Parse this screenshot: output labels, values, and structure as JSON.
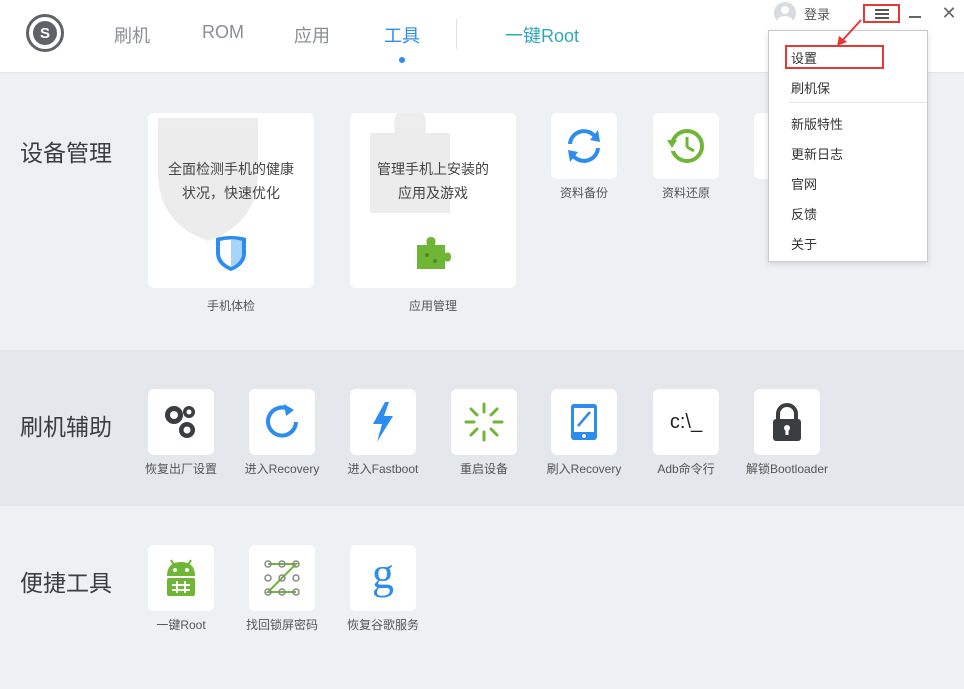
{
  "nav": {
    "tabs": [
      "刷机",
      "ROM",
      "应用",
      "工具"
    ],
    "root_tab": "一键Root"
  },
  "header": {
    "login": "登录"
  },
  "menu": {
    "items": [
      "设置",
      "刷机保",
      "新版特性",
      "更新日志",
      "官网",
      "反馈",
      "关于"
    ]
  },
  "sections": {
    "device": {
      "title": "设备管理",
      "check_card": {
        "desc_line1": "全面检测手机的健康",
        "desc_line2": "状况，快速优化",
        "label": "手机体检"
      },
      "app_card": {
        "desc_line1": "管理手机上安装的",
        "desc_line2": "应用及游戏",
        "label": "应用管理"
      },
      "tiles": [
        "资料备份",
        "资料还原"
      ]
    },
    "flash": {
      "title": "刷机辅助",
      "tiles": [
        "恢复出厂设置",
        "进入Recovery",
        "进入Fastboot",
        "重启设备",
        "刷入Recovery",
        "Adb命令行",
        "解锁Bootloader"
      ],
      "adb_glyph": "c:\\_"
    },
    "tools": {
      "title": "便捷工具",
      "tiles": [
        "一键Root",
        "找回锁屏密码",
        "恢复谷歌服务"
      ],
      "google_glyph": "g"
    }
  },
  "colors": {
    "accent": "#2d8cf0",
    "green": "#6fb536",
    "highlight": "#e53935",
    "root": "#2fa9b8"
  },
  "icons": [
    "logo-icon",
    "user-icon",
    "menu-icon",
    "minimize-icon",
    "close-icon",
    "shield-icon",
    "puzzle-icon",
    "sync-icon",
    "restore-clock-icon",
    "gears-icon",
    "refresh-icon",
    "lightning-icon",
    "loading-icon",
    "tablet-icon",
    "terminal-icon",
    "lock-icon",
    "android-icon",
    "pattern-icon",
    "google-icon"
  ]
}
